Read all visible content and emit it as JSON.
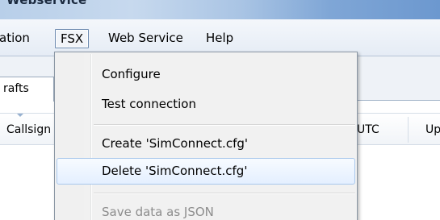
{
  "window": {
    "title": "Webservice"
  },
  "menubar": {
    "items": [
      {
        "label": "ation"
      },
      {
        "label": "FSX"
      },
      {
        "label": "Web Service"
      },
      {
        "label": "Help"
      }
    ]
  },
  "tabs": [
    {
      "label": "rafts"
    }
  ],
  "grid": {
    "columns": [
      {
        "label": "Callsign"
      },
      {
        "label": "UTC"
      },
      {
        "label": "Up"
      }
    ]
  },
  "fsx_menu": {
    "items": [
      {
        "label": "Configure",
        "enabled": true
      },
      {
        "label": "Test connection",
        "enabled": true
      },
      {
        "label": "Create 'SimConnect.cfg'",
        "enabled": true
      },
      {
        "label": "Delete 'SimConnect.cfg'",
        "enabled": true,
        "highlighted": true
      },
      {
        "label": "Save data as JSON",
        "enabled": false
      }
    ]
  }
}
